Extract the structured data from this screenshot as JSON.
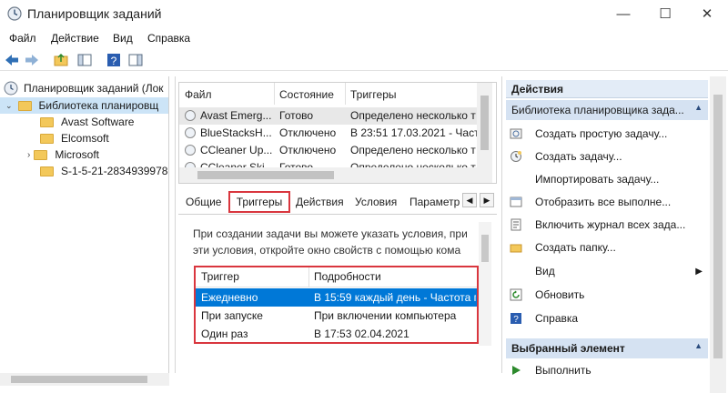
{
  "window": {
    "title": "Планировщик заданий",
    "controls": {
      "minimize": "—",
      "maximize": "☐",
      "close": "✕"
    }
  },
  "menu": [
    "Файл",
    "Действие",
    "Вид",
    "Справка"
  ],
  "tree": {
    "root": "Планировщик заданий (Лок",
    "library": "Библиотека планировщ",
    "folders": [
      "Avast Software",
      "Elcomsoft",
      "Microsoft",
      "S-1-5-21-2834939978-"
    ]
  },
  "task_list": {
    "headers": [
      "Файл",
      "Состояние",
      "Триггеры"
    ],
    "rows": [
      {
        "name": "Avast Emerg...",
        "status": "Готово",
        "trigger": "Определено несколько т"
      },
      {
        "name": "BlueStacksH...",
        "status": "Отключено",
        "trigger": "В 23:51 17.03.2021 - Часто"
      },
      {
        "name": "CCleaner Up...",
        "status": "Отключено",
        "trigger": "Определено несколько т"
      },
      {
        "name": "CCleaner Ski...",
        "status": "Готово",
        "trigger": "Определено несколько т"
      }
    ]
  },
  "tabs": [
    "Общие",
    "Триггеры",
    "Действия",
    "Условия",
    "Параметр"
  ],
  "tab_nav": {
    "left": "◀",
    "right": "▶"
  },
  "triggers_panel": {
    "description_line1": "При создании задачи вы можете указать условия, при",
    "description_line2": "эти условия, откройте окно свойств с помощью кома",
    "headers": [
      "Триггер",
      "Подробности"
    ],
    "rows": [
      {
        "trigger": "Ежедневно",
        "details": "В 15:59 каждый день - Частота п",
        "selected": true
      },
      {
        "trigger": "При запуске",
        "details": "При включении компьютера",
        "selected": false
      },
      {
        "trigger": "Один раз",
        "details": "В 17:53 02.04.2021",
        "selected": false
      }
    ]
  },
  "actions": {
    "header": "Действия",
    "section1": "Библиотека планировщика зада...",
    "items": [
      {
        "label": "Создать простую задачу...",
        "icon": "wizard-icon"
      },
      {
        "label": "Создать задачу...",
        "icon": "create-task-icon"
      },
      {
        "label": "Импортировать задачу...",
        "icon": ""
      },
      {
        "label": "Отобразить все выполне...",
        "icon": "running-tasks-icon"
      },
      {
        "label": "Включить журнал всех зада...",
        "icon": "log-icon"
      },
      {
        "label": "Создать папку...",
        "icon": "folder-icon"
      },
      {
        "label": "Вид",
        "icon": ""
      },
      {
        "label": "Обновить",
        "icon": "refresh-icon"
      },
      {
        "label": "Справка",
        "icon": "help-icon"
      }
    ],
    "section2": "Выбранный элемент",
    "items2": [
      {
        "label": "Выполнить",
        "icon": "run-icon"
      }
    ]
  },
  "colors": {
    "highlight": "#d9363e",
    "selection": "#0078d7",
    "action_header": "#e3ecf7"
  }
}
